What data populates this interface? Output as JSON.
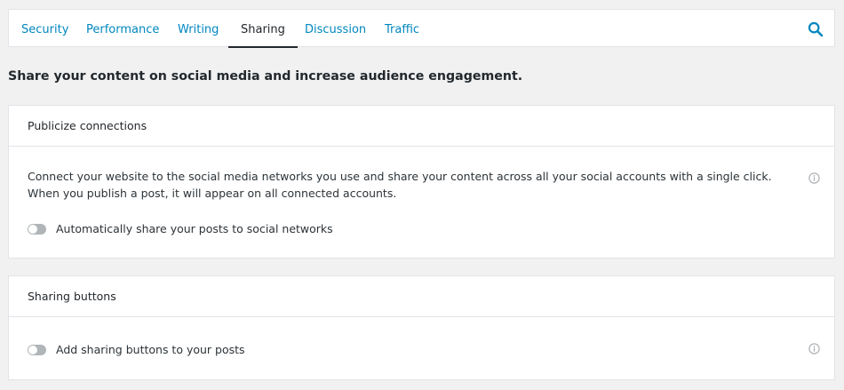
{
  "tabs": [
    {
      "label": "Security"
    },
    {
      "label": "Performance"
    },
    {
      "label": "Writing"
    },
    {
      "label": "Sharing",
      "active": true
    },
    {
      "label": "Discussion"
    },
    {
      "label": "Traffic"
    }
  ],
  "search_icon": "search-icon",
  "lead": "Share your content on social media and increase audience engagement.",
  "publicize": {
    "title": "Publicize connections",
    "description": "Connect your website to the social media networks you use and share your content across all your social accounts with a single click. When you publish a post, it will appear on all connected accounts.",
    "toggle_label": "Automatically share your posts to social networks",
    "toggle_on": false,
    "info_icon": "info-icon"
  },
  "sharing_buttons": {
    "title": "Sharing buttons",
    "toggle_label": "Add sharing buttons to your posts",
    "toggle_on": false,
    "info_icon": "info-icon"
  },
  "colors": {
    "accent": "#0087be",
    "text": "#23282d",
    "background": "#f1f1f1",
    "toggle_off": "#b0b5b8"
  }
}
